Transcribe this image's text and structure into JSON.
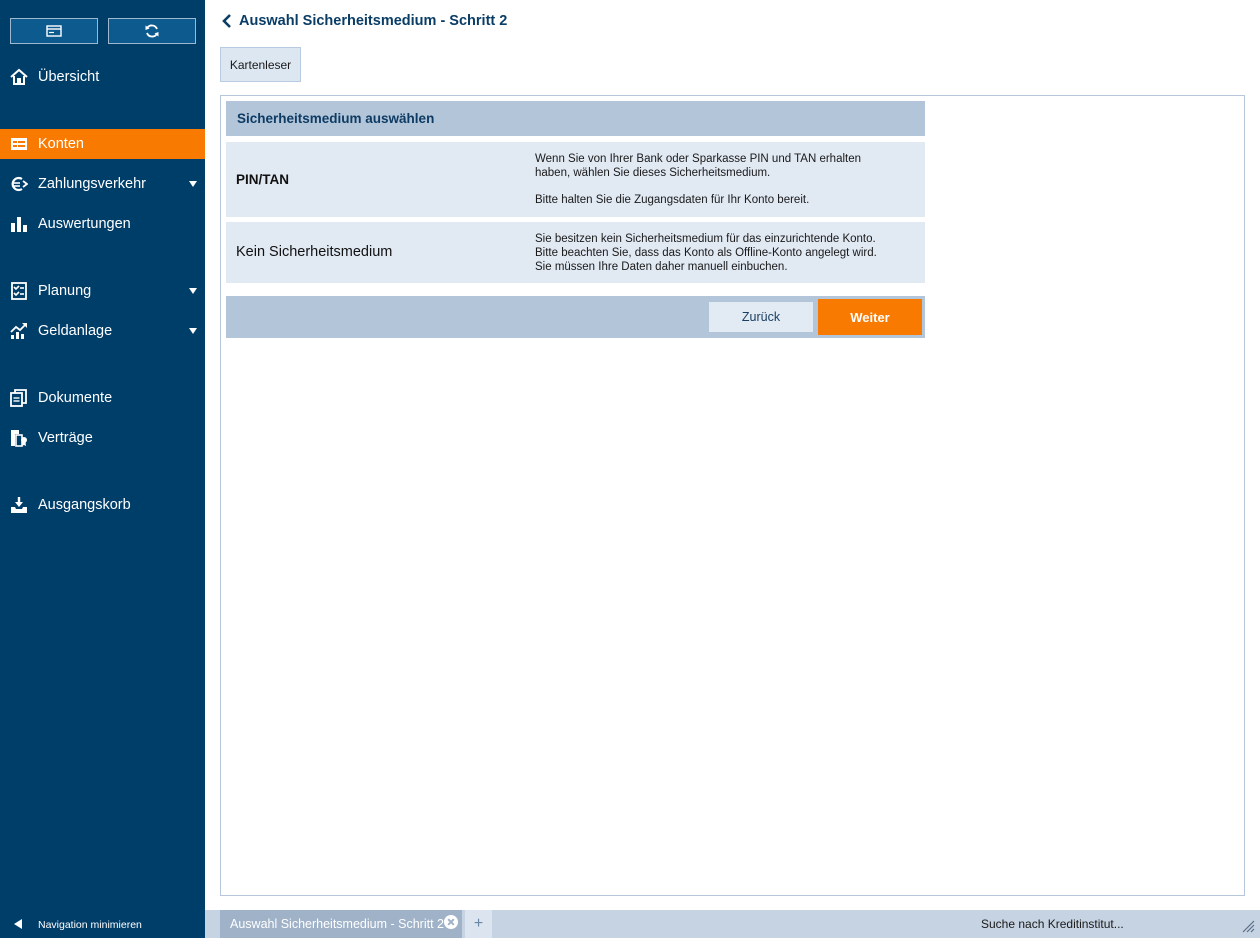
{
  "sidebar": {
    "top_buttons": [
      {
        "icon": "card-icon"
      },
      {
        "icon": "refresh-icon"
      }
    ],
    "items": [
      {
        "label": "Übersicht",
        "icon": "home-icon",
        "active": false,
        "has_submenu": false
      },
      {
        "label": "Konten",
        "icon": "accounts-icon",
        "active": true,
        "has_submenu": false
      },
      {
        "label": "Zahlungsverkehr",
        "icon": "euro-icon",
        "active": false,
        "has_submenu": true
      },
      {
        "label": "Auswertungen",
        "icon": "bar-chart-icon",
        "active": false,
        "has_submenu": false
      },
      {
        "label": "Planung",
        "icon": "planning-icon",
        "active": false,
        "has_submenu": true
      },
      {
        "label": "Geldanlage",
        "icon": "investment-icon",
        "active": false,
        "has_submenu": true
      },
      {
        "label": "Dokumente",
        "icon": "documents-icon",
        "active": false,
        "has_submenu": false
      },
      {
        "label": "Verträge",
        "icon": "contracts-icon",
        "active": false,
        "has_submenu": false
      },
      {
        "label": "Ausgangskorb",
        "icon": "outbox-icon",
        "active": false,
        "has_submenu": false
      }
    ],
    "minimize_label": "Navigation minimieren"
  },
  "header": {
    "title": "Auswahl Sicherheitsmedium - Schritt 2",
    "card_reader_button": "Kartenleser"
  },
  "panel": {
    "title": "Sicherheitsmedium auswählen",
    "options": [
      {
        "title": "PIN/TAN",
        "description_lines": [
          "Wenn Sie von Ihrer Bank oder Sparkasse PIN und TAN erhalten",
          "haben, wählen Sie dieses Sicherheitsmedium."
        ],
        "description_extra": "Bitte halten Sie die Zugangsdaten für Ihr Konto bereit."
      },
      {
        "title": "Kein Sicherheitsmedium",
        "description_lines": [
          "Sie besitzen kein Sicherheitsmedium für das einzurichtende Konto.",
          "Bitte beachten Sie, dass das Konto als Offline-Konto angelegt wird.",
          "Sie müssen Ihre Daten daher manuell einbuchen."
        ]
      }
    ],
    "back_button": "Zurück",
    "next_button": "Weiter"
  },
  "bottom_bar": {
    "tab_label": "Auswahl Sicherheitsmedium - Schritt 2",
    "add_tab": "+",
    "status": "Suche nach Kreditinstitut..."
  },
  "colors": {
    "sidebar_bg": "#003e6a",
    "accent": "#f87a00",
    "panel_header": "#b3c5d9",
    "option_bg": "#e1e9f3"
  }
}
